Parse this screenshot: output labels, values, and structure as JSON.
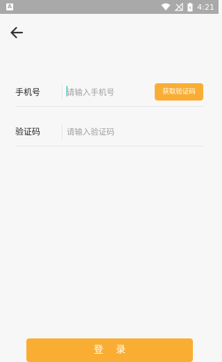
{
  "status_bar": {
    "app_icon_letter": "A",
    "time": "4:21",
    "icons": [
      "wifi-icon",
      "signal-icon",
      "battery-icon"
    ]
  },
  "header": {
    "back_icon": "arrow-left-icon"
  },
  "form": {
    "phone": {
      "label": "手机号",
      "placeholder": "请输入手机号",
      "value": ""
    },
    "get_code_button_label": "获取验证码",
    "code": {
      "label": "验证码",
      "placeholder": "请输入验证码",
      "value": ""
    }
  },
  "login_button_label": "登录",
  "colors": {
    "accent": "#f9ae33",
    "status_bar": "#a9a9a9",
    "background": "#f7f7f7",
    "cursor": "#00a8b5"
  }
}
